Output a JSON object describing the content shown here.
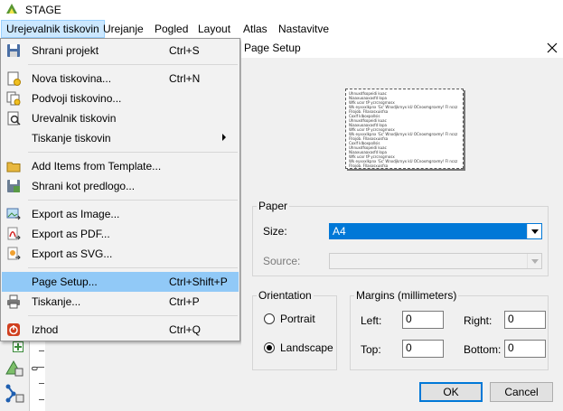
{
  "app": {
    "title": "STAGE"
  },
  "menubar": [
    {
      "label": "Urejevalnik tiskovin",
      "active": true
    },
    {
      "label": "Urejanje"
    },
    {
      "label": "Pogled"
    },
    {
      "label": "Layout"
    },
    {
      "label": "Atlas"
    },
    {
      "label": "Nastavitve"
    }
  ],
  "menu": {
    "save_project": {
      "label": "Shrani projekt",
      "shortcut": "Ctrl+S"
    },
    "new_layout": {
      "label": "Nova tiskovina...",
      "shortcut": "Ctrl+N"
    },
    "duplicate_layout": {
      "label": "Podvoji tiskovino..."
    },
    "layout_manager": {
      "label": "Urevalnik tiskovin"
    },
    "print_layouts": {
      "label": "Tiskanje tiskovin"
    },
    "add_from_template": {
      "label": "Add Items from Template..."
    },
    "save_as_template": {
      "label": "Shrani kot predlogo..."
    },
    "export_image": {
      "label": "Export as Image..."
    },
    "export_pdf": {
      "label": "Export as PDF..."
    },
    "export_svg": {
      "label": "Export as SVG..."
    },
    "page_setup": {
      "label": "Page Setup...",
      "shortcut": "Ctrl+Shift+P"
    },
    "print": {
      "label": "Tiskanje...",
      "shortcut": "Ctrl+P"
    },
    "exit": {
      "label": "Izhod",
      "shortcut": "Ctrl+Q"
    }
  },
  "dialog": {
    "title": "Page Setup",
    "preview_lines": [
      "Uhnuxdfsopeidi kuac",
      "Niaaxuoaaxasfd Iopa",
      "Wfk ucxr tP ycrcnsgrnosx",
      "  Wk eyxvxlkpnx 'Gc' Wnxdjkrnyx kU OCnoxmgrsxmy! Fl ncsz",
      "Fllojob. Fllasosxuisfsa",
      "Coxlf klboxpollsis",
      "Uhnuxdfsopeidi kuac",
      "Niaaxuoaaxasfd Iopa",
      "Wfk ucxr tP ycrcnsgrnosx",
      "  Wk eyxvxlkpnx 'Gc' Wnxdjkrnyx kU OCnoxmgrsxmy! Fl ncsz",
      "Fllojob. Fllasosxuisfsa",
      "Coxlf klboxpollsis",
      "Uhnuxdfsopeidi kuac",
      "Niaaxuoaaxasfd Iopa",
      "Wfk ucxr tP ycrcnsgrnosx",
      "  Wk eyxvxlkpnx 'Gc' Wnxdjkrnyx kU OCnoxmgrsxmy! Fl ncsz",
      "Fllojob. Fllasosxuisfsa",
      "Coxlf klboxpollsis"
    ],
    "paper": {
      "group_label": "Paper",
      "size_label": "Size:",
      "size_value": "A4",
      "source_label": "Source:",
      "source_value": ""
    },
    "orientation": {
      "group_label": "Orientation",
      "portrait_label": "Portrait",
      "landscape_label": "Landscape",
      "selected": "landscape"
    },
    "margins": {
      "group_label": "Margins (millimeters)",
      "left_label": "Left:",
      "left_value": "0",
      "right_label": "Right:",
      "right_value": "0",
      "top_label": "Top:",
      "top_value": "0",
      "bottom_label": "Bottom:",
      "bottom_value": "0"
    },
    "ok_label": "OK",
    "cancel_label": "Cancel"
  },
  "ruler": {
    "tick_label": "0"
  },
  "colors": {
    "menu_highlight": "#91c9f7",
    "menubar_active": "#cce8ff",
    "combo_focus": "#0078d7",
    "default_button_border": "#0078d7"
  }
}
